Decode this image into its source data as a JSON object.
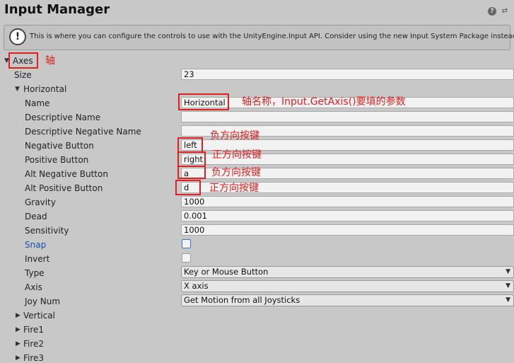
{
  "header": {
    "title": "Input Manager",
    "help_icon": "help-icon",
    "settings_icon": "settings-icon"
  },
  "banner": {
    "icon": "warning-icon",
    "text": "This is where you can configure the controls to use with the UnityEngine.Input API. Consider using the new Input System Package instead."
  },
  "axes": {
    "label": "Axes",
    "size_label": "Size",
    "size_value": "23"
  },
  "horizontal": {
    "label": "Horizontal",
    "fields": {
      "name": {
        "label": "Name",
        "value": "Horizontal"
      },
      "descriptive_name": {
        "label": "Descriptive Name",
        "value": ""
      },
      "descriptive_negative_name": {
        "label": "Descriptive Negative Name",
        "value": ""
      },
      "negative_button": {
        "label": "Negative Button",
        "value": "left"
      },
      "positive_button": {
        "label": "Positive Button",
        "value": "right"
      },
      "alt_negative_button": {
        "label": "Alt Negative Button",
        "value": "a"
      },
      "alt_positive_button": {
        "label": "Alt Positive Button",
        "value": "d"
      },
      "gravity": {
        "label": "Gravity",
        "value": "1000"
      },
      "dead": {
        "label": "Dead",
        "value": "0.001"
      },
      "sensitivity": {
        "label": "Sensitivity",
        "value": "1000"
      },
      "snap": {
        "label": "Snap",
        "checked": false
      },
      "invert": {
        "label": "Invert",
        "checked": false
      },
      "type": {
        "label": "Type",
        "value": "Key or Mouse Button"
      },
      "axis": {
        "label": "Axis",
        "value": "X axis"
      },
      "joy_num": {
        "label": "Joy Num",
        "value": "Get Motion from all Joysticks"
      }
    }
  },
  "collapsed_axes": [
    "Vertical",
    "Fire1",
    "Fire2",
    "Fire3"
  ],
  "annotations": {
    "axes": "轴",
    "name": "轴名称，Input.GetAxis()要填的参数",
    "negative": "负方向按键",
    "positive": "正方向按键",
    "alt_negative": "负方向按键",
    "alt_positive": "正方向按键"
  },
  "colors": {
    "background": "#c8c8c8",
    "annotation_red": "#e02020",
    "snap_blue": "#1b4fb0"
  }
}
